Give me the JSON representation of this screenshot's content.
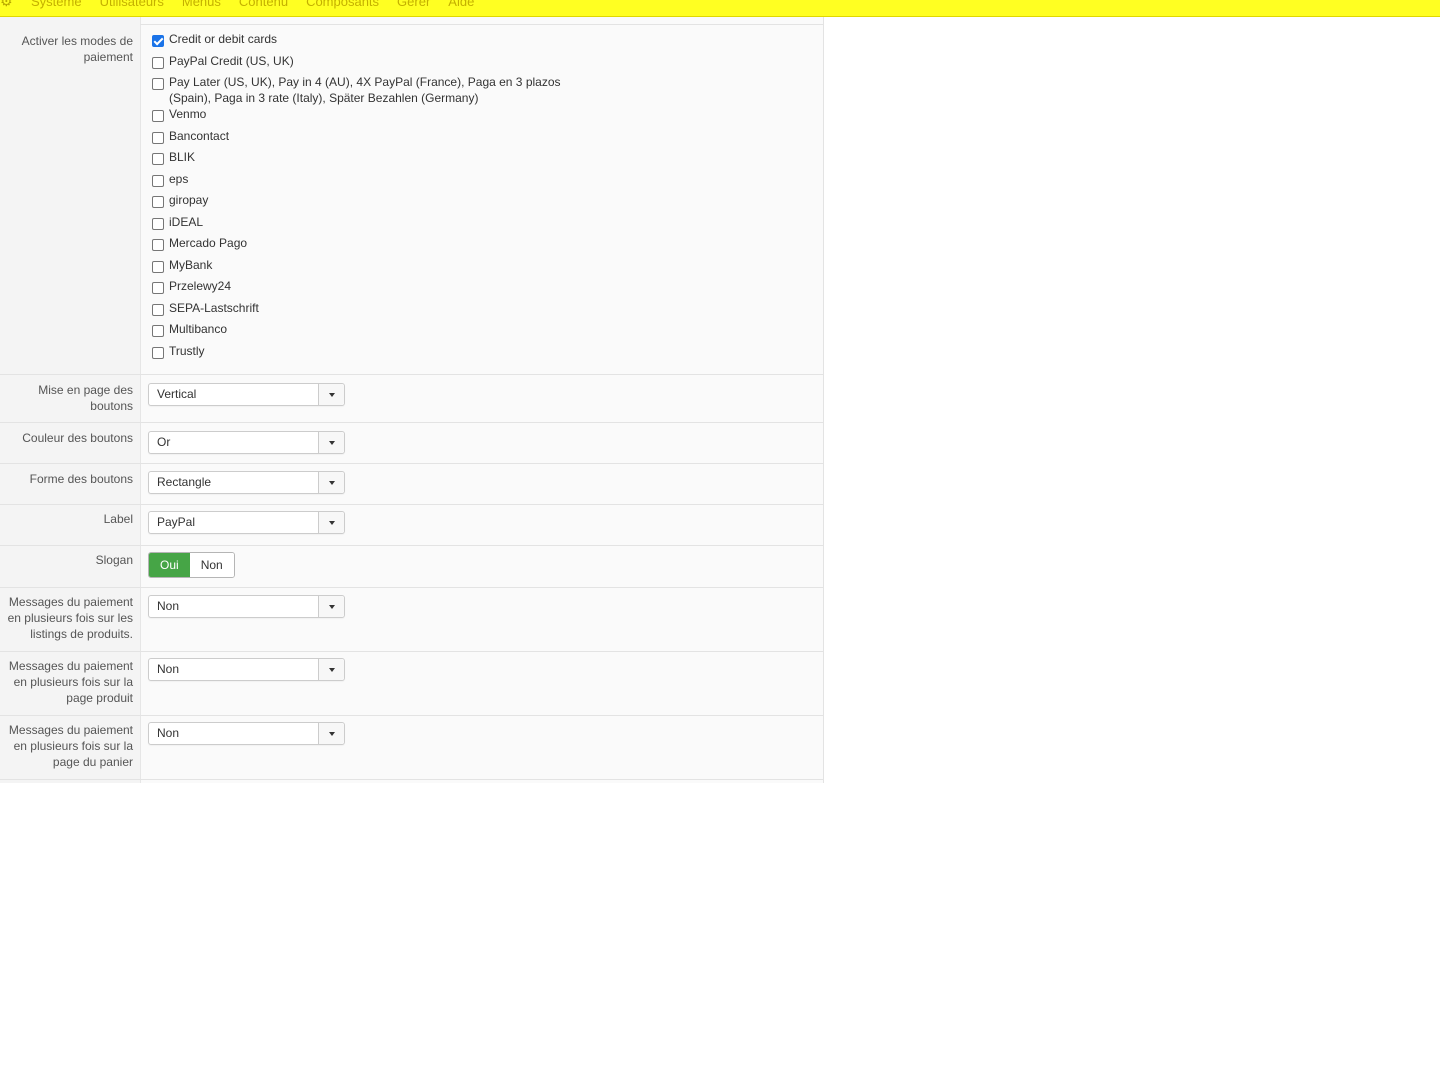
{
  "menu": {
    "logo_glyph": "⚙",
    "items": [
      "Système",
      "Utilisateurs",
      "Menus",
      "Contenu",
      "Composants",
      "Gérer",
      "Aide"
    ]
  },
  "form": {
    "payment_modes": {
      "label": "Activer les modes de paiement",
      "options": [
        {
          "text": "Credit or debit cards",
          "checked": true
        },
        {
          "text": "PayPal Credit (US, UK)",
          "checked": false
        },
        {
          "text": "Pay Later (US, UK), Pay in 4 (AU), 4X PayPal (France), Paga en 3 plazos (Spain), Paga in 3 rate (Italy), Später Bezahlen (Germany)",
          "checked": false
        },
        {
          "text": "Venmo",
          "checked": false
        },
        {
          "text": "Bancontact",
          "checked": false
        },
        {
          "text": "BLIK",
          "checked": false
        },
        {
          "text": "eps",
          "checked": false
        },
        {
          "text": "giropay",
          "checked": false
        },
        {
          "text": "iDEAL",
          "checked": false
        },
        {
          "text": "Mercado Pago",
          "checked": false
        },
        {
          "text": "MyBank",
          "checked": false
        },
        {
          "text": "Przelewy24",
          "checked": false
        },
        {
          "text": "SEPA-Lastschrift",
          "checked": false
        },
        {
          "text": "Multibanco",
          "checked": false
        },
        {
          "text": "Trustly",
          "checked": false
        }
      ]
    },
    "button_layout": {
      "label": "Mise en page des boutons",
      "value": "Vertical"
    },
    "button_color": {
      "label": "Couleur des boutons",
      "value": "Or"
    },
    "button_shape": {
      "label": "Forme des boutons",
      "value": "Rectangle"
    },
    "button_label": {
      "label": "Label",
      "value": "PayPal"
    },
    "slogan": {
      "label": "Slogan",
      "yes": "Oui",
      "no": "Non",
      "selected": "Oui"
    },
    "msg_listings": {
      "label": "Messages du paiement en plusieurs fois sur les listings de produits.",
      "value": "Non"
    },
    "msg_product": {
      "label": "Messages du paiement en plusieurs fois sur la page produit",
      "value": "Non"
    },
    "msg_cart": {
      "label": "Messages du paiement en plusieurs fois sur la page du panier",
      "value": "Non"
    }
  },
  "colors": {
    "menubar": "#ffff22",
    "toggle_active": "#46a546",
    "checkbox_checked": "#1a73e8"
  }
}
